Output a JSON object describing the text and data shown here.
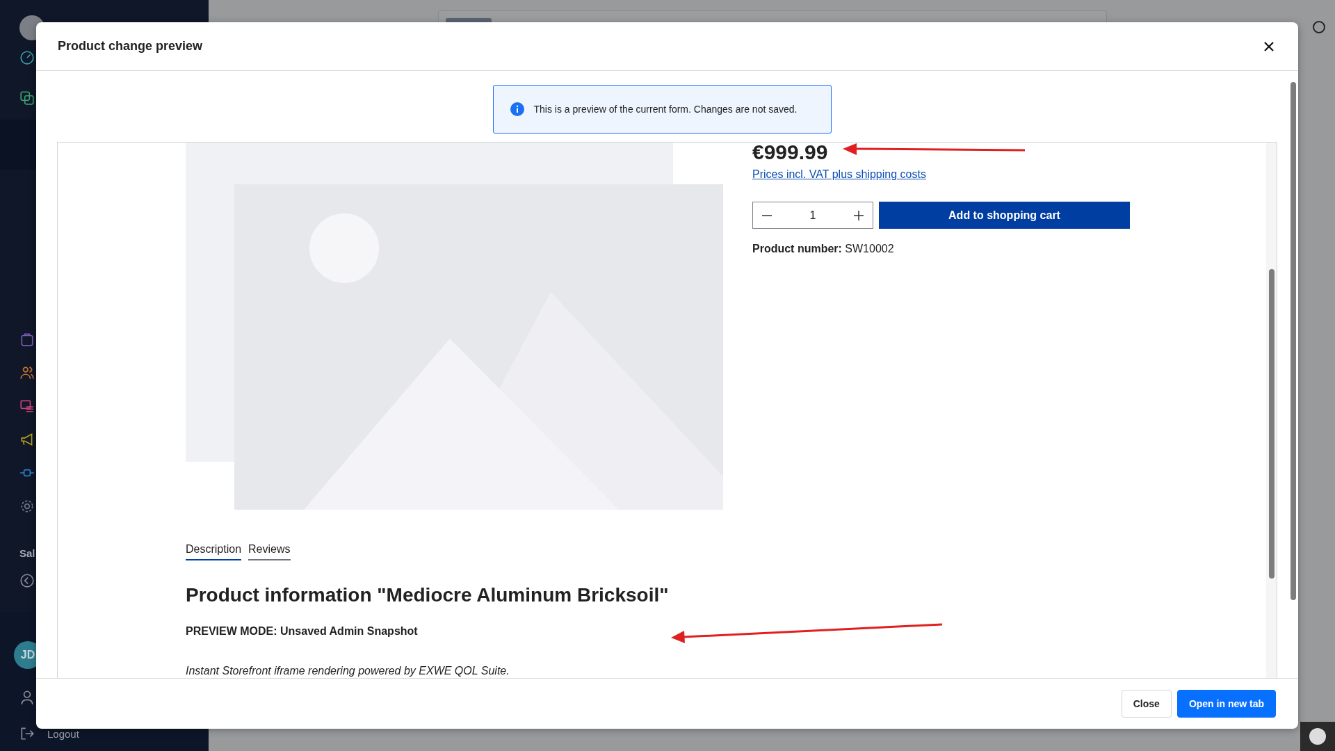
{
  "sidebar": {
    "section_label": "Sal",
    "avatar_initials": "JD",
    "logout": "Logout"
  },
  "modal": {
    "title": "Product change preview",
    "notice": "This is a preview of the current form. Changes are not saved.",
    "buttons": [
      {
        "label": "Close",
        "kind": "secondary"
      },
      {
        "label": "Open in new tab",
        "kind": "primary"
      }
    ]
  },
  "product": {
    "price": "€999.99",
    "price_note": "Prices incl. VAT plus shipping costs",
    "quantity": "1",
    "add_to_cart": "Add to shopping cart",
    "product_number": "**Product number:** SW10002",
    "tabs": [
      {
        "label": "Description",
        "selected": true
      },
      {
        "label": "Reviews",
        "selected": false
      }
    ],
    "heading": "Product information \"Mediocre Aluminum Bricksoil\"",
    "preview_mode": "PREVIEW MODE: Unsaved Admin Snapshot",
    "note": "Instant Storefront iframe rendering powered by EXWE QOL Suite."
  }
}
